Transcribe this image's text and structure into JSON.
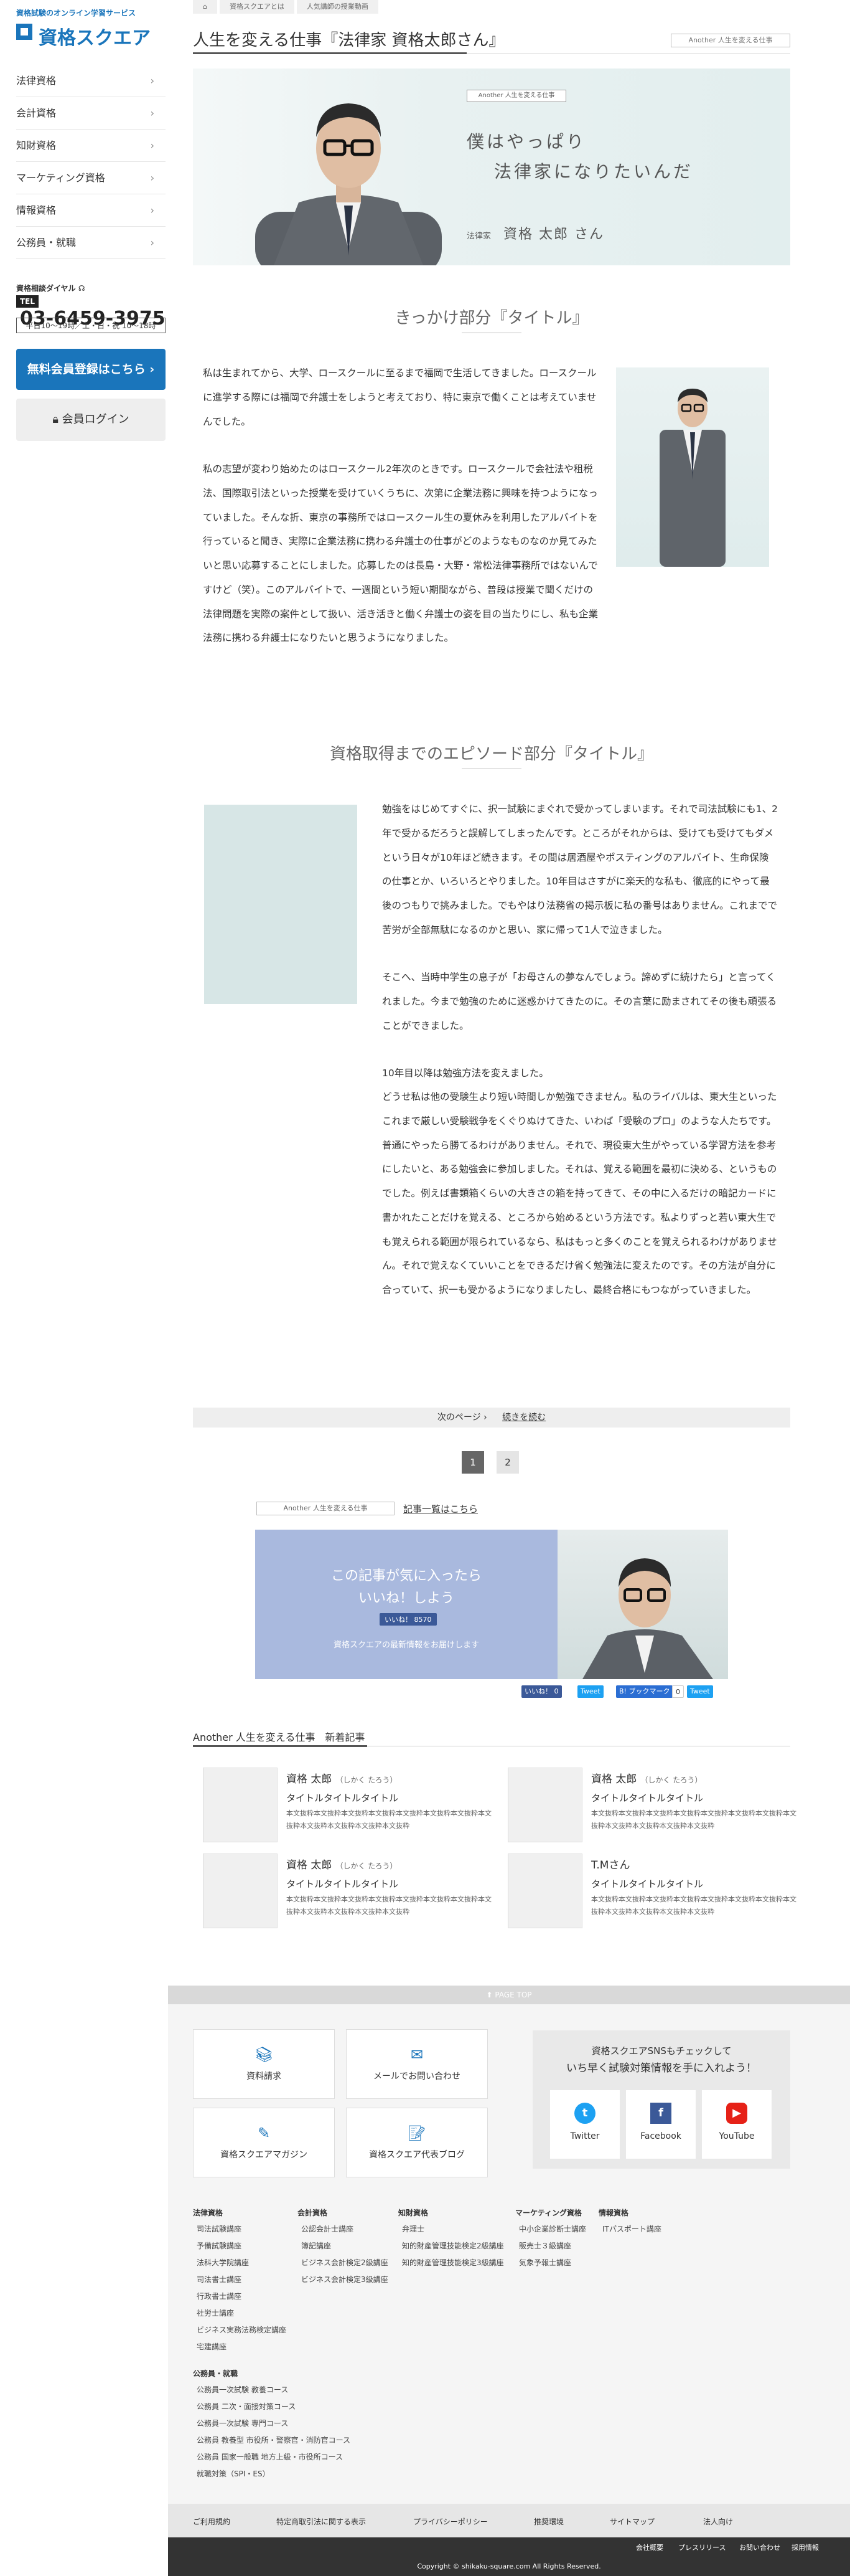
{
  "brand": {
    "tagline": "資格試験のオンライン学習サービス",
    "name": "資格スクエア"
  },
  "sidebar": {
    "items": [
      {
        "label": "法律資格"
      },
      {
        "label": "会計資格"
      },
      {
        "label": "知財資格"
      },
      {
        "label": "マーケティング資格"
      },
      {
        "label": "情報資格"
      },
      {
        "label": "公務員・就職"
      }
    ],
    "phone_label": "資格相談ダイヤル",
    "tel_badge": "TEL",
    "phone": "03-6459-3975",
    "hours": "平日10〜19時／土・日・祝 10〜18時",
    "register_button": "無料会員登録はこちら",
    "login_button": "会員ログイン"
  },
  "breadcrumb": [
    "資格スクエアとは",
    "人気講師の授業動画"
  ],
  "article": {
    "title": "人生を変える仕事『法律家 資格太郎さん』",
    "series_tag": "Another 人生を変える仕事",
    "hero": {
      "tag": "Another 人生を変える仕事",
      "copy1": "僕はやっぱり",
      "copy2": "法律家になりたいんだ",
      "role": "法律家",
      "name": "資格 太郎 さん"
    },
    "section1_title": "きっかけ部分『タイトル』",
    "section1_para1": "私は生まれてから、大学、ロースクールに至るまで福岡で生活してきました。ロースクールに進学する際には福岡で弁護士をしようと考えており、特に東京で働くことは考えていませんでした。",
    "section1_para2": "私の志望が変わり始めたのはロースクール2年次のときです。ロースクールで会社法や租税法、国際取引法といった授業を受けていくうちに、次第に企業法務に興味を持つようになっていました。そんな折、東京の事務所ではロースクール生の夏休みを利用したアルバイトを行っていると聞き、実際に企業法務に携わる弁護士の仕事がどのようなものなのか見てみたいと思い応募することにしました。応募したのは長島・大野・常松法律事務所ではないんですけど（笑）。このアルバイトで、一週間という短い期間ながら、普段は授業で聞くだけの法律問題を実際の案件として扱い、活き活きと働く弁護士の姿を目の当たりにし、私も企業法務に携わる弁護士になりたいと思うようになりました。",
    "section2_title": "資格取得までのエピソード部分『タイトル』",
    "section2_para1": "勉強をはじめてすぐに、択一試験にまぐれで受かってしまいます。それで司法試験にも1、2年で受かるだろうと誤解してしまったんです。ところがそれからは、受けても受けてもダメという日々が10年ほど続きます。その間は居酒屋やポスティングのアルバイト、生命保険の仕事とか、いろいろとやりました。10年目はさすがに楽天的な私も、徹底的にやって最後のつもりで挑みました。でもやはり法務省の掲示板に私の番号はありません。これまでで苦労が全部無駄になるのかと思い、家に帰って1人で泣きました。",
    "section2_para2": "そこへ、当時中学生の息子が「お母さんの夢なんでしょう。諦めずに続けたら」と言ってくれました。今まで勉強のために迷惑かけてきたのに。その言葉に励まされてその後も頑張ることができました。",
    "section2_para3": "10年目以降は勉強方法を変えました。",
    "section2_para4": "どうせ私は他の受験生より短い時間しか勉強できません。私のライバルは、東大生といったこれまで厳しい受験戦争をくぐりぬけてきた、いわば「受験のプロ」のような人たちです。普通にやったら勝てるわけがありません。それで、現役東大生がやっている学習方法を参考にしたいと、ある勉強会に参加しました。それは、覚える範囲を最初に決める、というものでした。例えば書類箱くらいの大きさの箱を持ってきて、その中に入るだけの暗記カードに書かれたことだけを覚える、ところから始めるという方法です。私よりずっと若い東大生でも覚えられる範囲が限られているなら、私はもっと多くのことを覚えられるわけがありません。それで覚えなくていいことをできるだけ省く勉強法に変えたのです。その方法が自分に合っていて、択一も受かるようになりましたし、最終合格にもつながっていきました。",
    "next_label": "次のページ",
    "read_more": "続きを読む",
    "pages": [
      "1",
      "2"
    ]
  },
  "related": {
    "tag": "Another 人生を変える仕事",
    "list_link": "記事一覧はこちら",
    "like_copy1": "この記事が気に入ったら",
    "like_copy2": "いいね！しよう",
    "like_button": "いいね！ 8570",
    "like_note": "資格スクエアの最新情報をお届けします",
    "share": [
      "いいね！ 0",
      "Tweet",
      "B! ブックマーク",
      "0",
      "Tweet"
    ]
  },
  "newlist": {
    "title": "Another 人生を変える仕事　新着記事",
    "cards": [
      {
        "name": "資格 太郎",
        "kana": "（しかく たろう）",
        "title": "タイトルタイトルタイトル",
        "body": "本文抜粋本文抜粋本文抜粋本文抜粋本文抜粋本文抜粋本文抜粋本文抜粋本文抜粋本文抜粋本文抜粋本文抜粋"
      },
      {
        "name": "資格 太郎",
        "kana": "（しかく たろう）",
        "title": "タイトルタイトルタイトル",
        "body": "本文抜粋本文抜粋本文抜粋本文抜粋本文抜粋本文抜粋本文抜粋本文抜粋本文抜粋本文抜粋本文抜粋本文抜粋"
      },
      {
        "name": "資格 太郎",
        "kana": "（しかく たろう）",
        "title": "タイトルタイトルタイトル",
        "body": "本文抜粋本文抜粋本文抜粋本文抜粋本文抜粋本文抜粋本文抜粋本文抜粋本文抜粋本文抜粋本文抜粋本文抜粋"
      },
      {
        "name": "T.Mさん",
        "kana": "",
        "title": "タイトルタイトルタイトル",
        "body": "本文抜粋本文抜粋本文抜粋本文抜粋本文抜粋本文抜粋本文抜粋本文抜粋本文抜粋本文抜粋本文抜粋本文抜粋"
      }
    ]
  },
  "footer": {
    "pagetop": "PAGE TOP",
    "cards": [
      {
        "label": "資料請求",
        "icon": "book-icon"
      },
      {
        "label": "メールでお問い合わせ",
        "icon": "mail-icon"
      },
      {
        "label": "資格スクエアマガジン",
        "icon": "magazine-icon"
      },
      {
        "label": "資格スクエア代表ブログ",
        "icon": "blog-icon"
      }
    ],
    "sns_title1": "資格スクエアSNSもチェックして",
    "sns_title2": "いち早く試験対策情報を手に入れよう！",
    "sns": [
      {
        "label": "Twitter",
        "color": "#1da1f2"
      },
      {
        "label": "Facebook",
        "color": "#3b5998"
      },
      {
        "label": "YouTube",
        "color": "#e62117"
      }
    ],
    "columns": [
      {
        "head": "法律資格",
        "items": [
          "司法試験講座",
          "予備試験講座",
          "法科大学院講座",
          "司法書士講座",
          "行政書士講座",
          "社労士講座",
          "ビジネス実務法務検定講座",
          "宅建講座"
        ]
      },
      {
        "head": "会計資格",
        "items": [
          "公認会計士講座",
          "簿記講座",
          "ビジネス会計検定2級講座",
          "ビジネス会計検定3級講座"
        ]
      },
      {
        "head": "知財資格",
        "items": [
          "弁理士",
          "知的財産管理技能検定2級講座",
          "知的財産管理技能検定3級講座"
        ]
      },
      {
        "head": "マーケティング資格",
        "items": [
          "中小企業診断士講座",
          "販売士３級講座",
          "気象予報士講座"
        ]
      },
      {
        "head": "情報資格",
        "items": [
          "ITパスポート講座"
        ]
      }
    ],
    "public": {
      "head": "公務員・就職",
      "items": [
        "公務員一次試験 教養コース",
        "公務員 二次・面接対策コース",
        "公務員一次試験 専門コース",
        "公務員 教養型 市役所・警察官・消防官コース",
        "公務員 国家一般職 地方上級・市役所コース",
        "就職対策（SPI・ES）"
      ]
    },
    "legal": [
      "ご利用規約",
      "特定商取引法に関する表示",
      "プライバシーポリシー",
      "推奨環境",
      "サイトマップ",
      "法人向け"
    ],
    "bottom": [
      "会社概要",
      "プレスリリース",
      "お問い合わせ",
      "採用情報"
    ],
    "copyright": "Copyright © shikaku-square.com All Rights Reserved."
  }
}
